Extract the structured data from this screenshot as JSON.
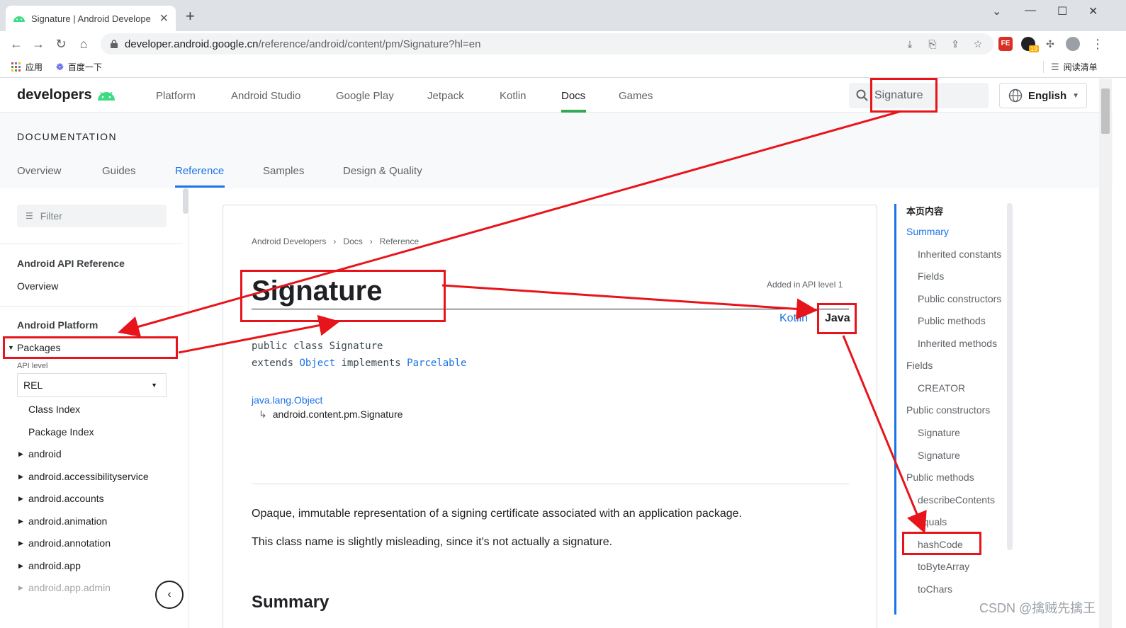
{
  "browser": {
    "tab_title": "Signature | Android Develope",
    "new_tab": "+",
    "url_host": "developer.android.google.cn",
    "url_path": "/reference/android/content/pm/Signature?hl=en",
    "bookmarks": [
      {
        "label": "应用",
        "icon": "apps-grid-icon"
      },
      {
        "label": "百度一下",
        "icon": "baidu-paw-icon"
      }
    ],
    "reading_list": "阅读清单",
    "ext_badge": "19"
  },
  "site": {
    "logo_text": "developers",
    "nav": [
      "Platform",
      "Android Studio",
      "Google Play",
      "Jetpack",
      "Kotlin",
      "Docs",
      "Games"
    ],
    "active_nav": "Docs",
    "search_value": "Signature",
    "language": "English"
  },
  "subheader": {
    "label": "DOCUMENTATION",
    "tabs": [
      "Overview",
      "Guides",
      "Reference",
      "Samples",
      "Design & Quality"
    ],
    "active_tab": "Reference"
  },
  "leftnav": {
    "filter_placeholder": "Filter",
    "api_ref": "Android API Reference",
    "overview": "Overview",
    "platform": "Android Platform",
    "packages": "Packages",
    "api_level_label": "API level",
    "api_level_value": "REL",
    "index_links": [
      "Class Index",
      "Package Index"
    ],
    "packages_list": [
      "android",
      "android.accessibilityservice",
      "android.accounts",
      "android.animation",
      "android.annotation",
      "android.app",
      "android.app.admin"
    ]
  },
  "content": {
    "breadcrumbs": [
      "Android Developers",
      "Docs",
      "Reference"
    ],
    "added": "Added in API level 1",
    "title": "Signature",
    "lang_kotlin": "Kotlin",
    "lang_java": "Java",
    "decl_line1": "public class Signature",
    "decl_extends": "extends ",
    "decl_object": "Object",
    "decl_implements": " implements ",
    "decl_parcelable": "Parcelable",
    "inherit_parent": "java.lang.Object",
    "inherit_child": "android.content.pm.Signature",
    "inherit_arrow": "↳",
    "para1": "Opaque, immutable representation of a signing certificate associated with an application package.",
    "para2": "This class name is slightly misleading, since it's not actually a signature.",
    "summary_heading": "Summary"
  },
  "toc": {
    "heading": "本页内容",
    "items": [
      {
        "label": "Summary",
        "level": 1,
        "active": true
      },
      {
        "label": "Inherited constants",
        "level": 2
      },
      {
        "label": "Fields",
        "level": 2
      },
      {
        "label": "Public constructors",
        "level": 2
      },
      {
        "label": "Public methods",
        "level": 2
      },
      {
        "label": "Inherited methods",
        "level": 2
      },
      {
        "label": "Fields",
        "level": 1
      },
      {
        "label": "CREATOR",
        "level": 2
      },
      {
        "label": "Public constructors",
        "level": 1
      },
      {
        "label": "Signature",
        "level": 2
      },
      {
        "label": "Signature",
        "level": 2
      },
      {
        "label": "Public methods",
        "level": 1
      },
      {
        "label": "describeContents",
        "level": 2
      },
      {
        "label": "equals",
        "level": 2
      },
      {
        "label": "hashCode",
        "level": 2
      },
      {
        "label": "toByteArray",
        "level": 2
      },
      {
        "label": "toChars",
        "level": 2
      }
    ]
  },
  "watermark": "CSDN @擒贼先擒王",
  "colors": {
    "accent": "#1a73e8",
    "android_green": "#3ddc84",
    "annotation_red": "#e8141b"
  }
}
